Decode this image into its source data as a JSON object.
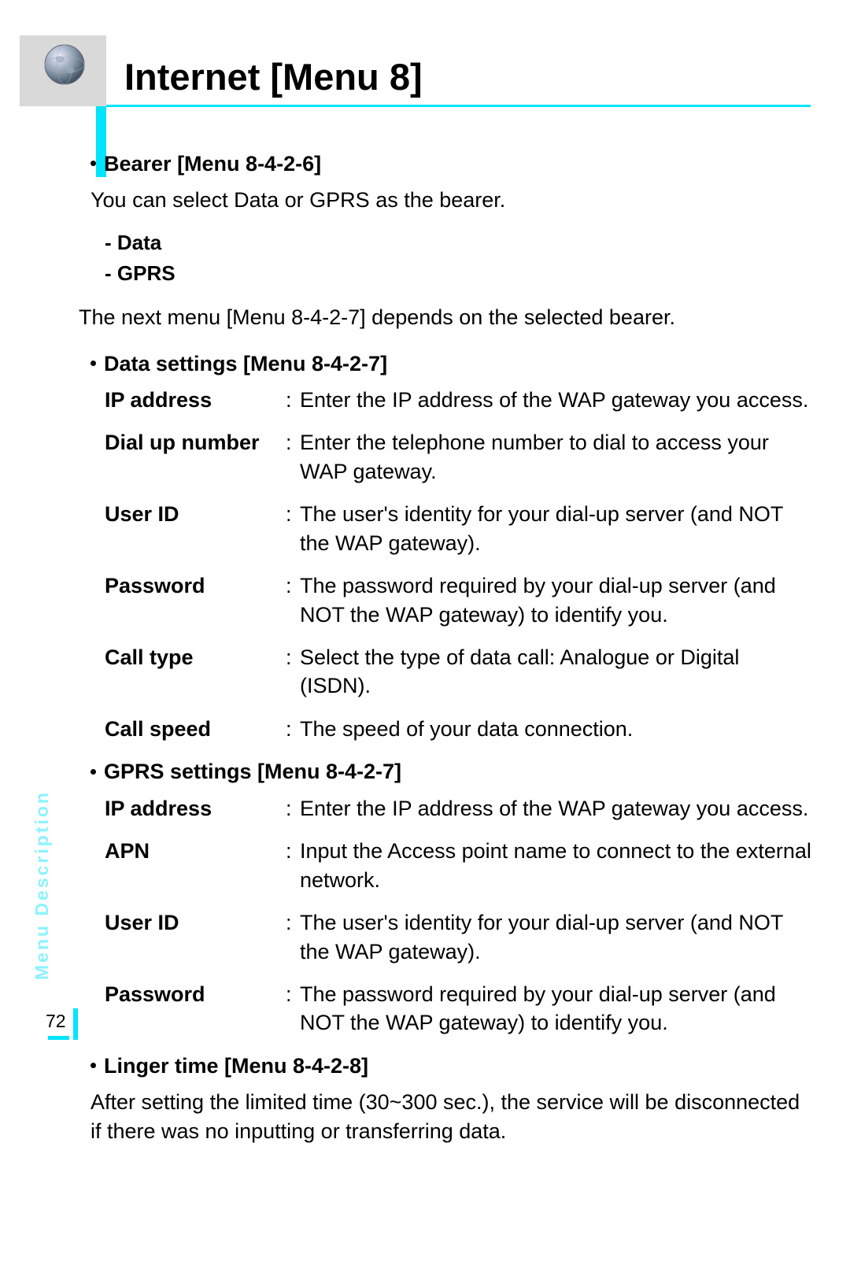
{
  "title": "Internet [Menu 8]",
  "sideLabel": "Menu Description",
  "pageNumber": "72",
  "bearer": {
    "heading": "Bearer [Menu 8-4-2-6]",
    "desc": "You can select Data or GPRS as the bearer.",
    "opt1": "- Data",
    "opt2": "- GPRS",
    "after": "The next menu [Menu 8-4-2-7] depends on the selected bearer."
  },
  "dataSettings": {
    "heading": "Data settings [Menu 8-4-2-7]",
    "rows": [
      {
        "term": "IP address",
        "desc": "Enter the IP address of the WAP gateway you access."
      },
      {
        "term": "Dial up number",
        "desc": "Enter the telephone number to dial to access your WAP gateway."
      },
      {
        "term": "User ID",
        "desc": "The user's identity for your dial-up server (and NOT the WAP gateway)."
      },
      {
        "term": "Password",
        "desc": "The password required by your dial-up server (and NOT the WAP gateway) to identify you."
      },
      {
        "term": "Call type",
        "desc": "Select the type of data call: Analogue or Digital (ISDN)."
      },
      {
        "term": "Call speed",
        "desc": "The speed of your data connection."
      }
    ]
  },
  "gprsSettings": {
    "heading": "GPRS settings [Menu 8-4-2-7]",
    "rows": [
      {
        "term": "IP address",
        "desc": "Enter the IP address of the WAP gateway you access."
      },
      {
        "term": "APN",
        "desc": "Input the Access point name to connect to the external network."
      },
      {
        "term": "User ID",
        "desc": "The user's identity for your dial-up server (and NOT the WAP gateway)."
      },
      {
        "term": "Password",
        "desc": "The password required by your dial-up server (and NOT the WAP gateway) to identify you."
      }
    ]
  },
  "linger": {
    "heading": "Linger time [Menu 8-4-2-8]",
    "desc": "After setting the limited time (30~300 sec.), the service will be disconnected if there was no inputting or transferring data."
  }
}
